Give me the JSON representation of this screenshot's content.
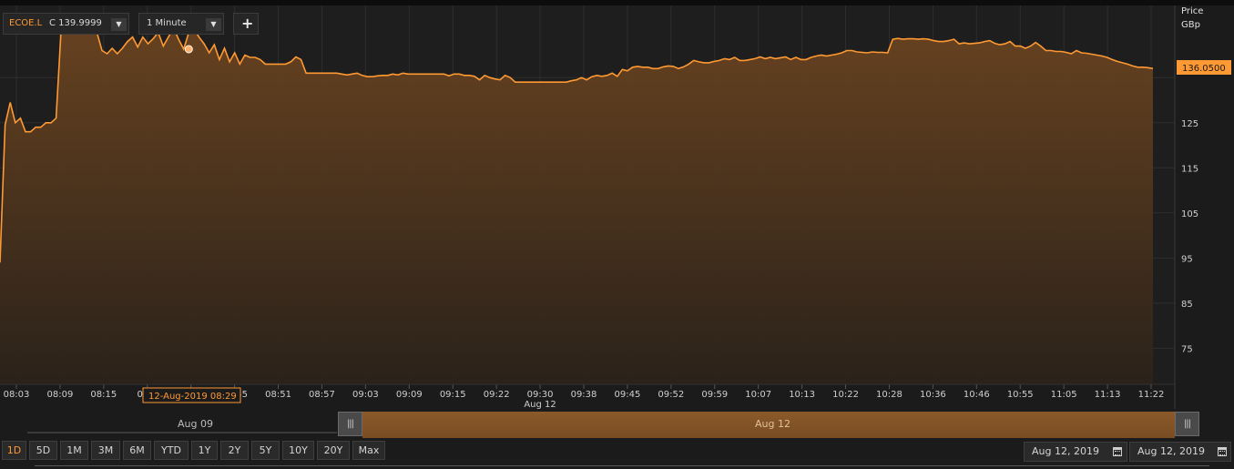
{
  "toolbar": {
    "symbol": "ECOE.L",
    "symbol_value": "C 139.9999",
    "interval": "1 Minute",
    "add_label": "+"
  },
  "axis": {
    "price_title": "Price",
    "price_unit": "GBp"
  },
  "hover_tooltip": "12-Aug-2019 08:29",
  "last_price_label": "136.0500",
  "date_range": {
    "from": "Aug 12, 2019",
    "to": "Aug 12, 2019"
  },
  "timeline": {
    "prev_label": "Aug 09",
    "current_label": "Aug 12"
  },
  "range_buttons": [
    "1D",
    "5D",
    "1M",
    "3M",
    "6M",
    "YTD",
    "1Y",
    "2Y",
    "5Y",
    "10Y",
    "20Y",
    "Max"
  ],
  "active_range": "1D",
  "colors": {
    "line": "#ff9933",
    "fill": "#5a3a1f",
    "background": "#1b1b1b",
    "grid": "#2e2e2e"
  },
  "chart_data": {
    "type": "area",
    "ylabel": "Price GBp",
    "ylim": [
      67,
      151
    ],
    "y_ticks": [
      75,
      85,
      95,
      105,
      115,
      125,
      135
    ],
    "x_tick_labels": [
      "08:03",
      "08:09",
      "08:15",
      "08:2",
      "08:39",
      "08:45",
      "08:51",
      "08:57",
      "09:03",
      "09:09",
      "09:15",
      "09:22",
      "09:30",
      "09:38",
      "09:45",
      "09:52",
      "09:59",
      "10:07",
      "10:13",
      "10:22",
      "10:28",
      "10:36",
      "10:46",
      "10:55",
      "11:05",
      "11:13",
      "11:22"
    ],
    "x_sublabel": "Aug 12",
    "grid": true,
    "last_value": 136.05,
    "hover_point": {
      "index": 37,
      "value": 141.3
    },
    "series": [
      {
        "values": [
          94,
          124.5,
          129.5,
          125,
          126,
          123,
          123,
          124,
          124,
          125,
          125,
          126,
          146,
          145.2,
          145.5,
          146,
          148,
          146,
          147,
          145,
          141,
          140.3,
          141.5,
          140.3,
          141.5,
          143,
          144,
          141.8,
          144,
          142.5,
          143.6,
          145,
          142,
          144,
          146,
          143.5,
          141.3,
          145,
          145.8,
          144,
          142.5,
          140.5,
          142.3,
          139,
          141.5,
          138.5,
          140.5,
          138,
          140,
          139.5,
          139.5,
          139,
          138,
          138,
          138,
          138,
          138,
          138.5,
          139.6,
          139,
          136,
          136,
          136,
          136,
          136,
          136,
          136,
          135.8,
          135.6,
          135.8,
          136,
          135.5,
          135.2,
          135.2,
          135.4,
          135.5,
          135.5,
          135.8,
          135.6,
          136,
          135.8,
          135.8,
          135.8,
          135.8,
          135.8,
          135.8,
          135.8,
          135.8,
          135.4,
          135.8,
          135.8,
          135.5,
          135.5,
          135.3,
          134.5,
          135.5,
          135,
          134.7,
          134.5,
          135.5,
          135,
          134,
          134,
          134,
          134,
          134,
          134,
          134,
          134,
          134,
          134,
          134,
          134.3,
          134.5,
          135,
          134.5,
          135.2,
          135.5,
          135.3,
          135.5,
          136,
          135.3,
          136.8,
          136.5,
          137.3,
          137.5,
          137.3,
          137.3,
          137,
          137,
          137.4,
          137.6,
          137.5,
          137,
          137.4,
          138,
          138.8,
          138.5,
          138.3,
          138.3,
          138.6,
          138.8,
          139.2,
          139,
          139.5,
          138.8,
          138.8,
          139,
          139.2,
          139.6,
          139.2,
          139.5,
          139.2,
          139.4,
          139.6,
          139,
          139.5,
          139,
          139,
          139.5,
          139.8,
          140,
          139.8,
          140,
          140.2,
          140.5,
          141,
          141,
          140.7,
          140.6,
          140.5,
          140.7,
          140.6,
          140.6,
          140.5,
          143.5,
          143.7,
          143.5,
          143.6,
          143.6,
          143.5,
          143.6,
          143.5,
          143.2,
          143,
          143,
          143.2,
          143.5,
          142.5,
          142.7,
          142.5,
          142.6,
          142.7,
          143,
          143.2,
          142.6,
          142.3,
          142.5,
          143,
          142,
          142,
          141.5,
          142,
          142.8,
          142,
          141,
          141,
          140.8,
          140.8,
          140.6,
          140.3,
          141,
          140.5,
          140.4,
          140.2,
          140,
          139.8,
          139.5,
          139,
          138.6,
          138.3,
          138,
          137.6,
          137.3,
          137.3,
          137.2,
          137
        ]
      }
    ]
  }
}
